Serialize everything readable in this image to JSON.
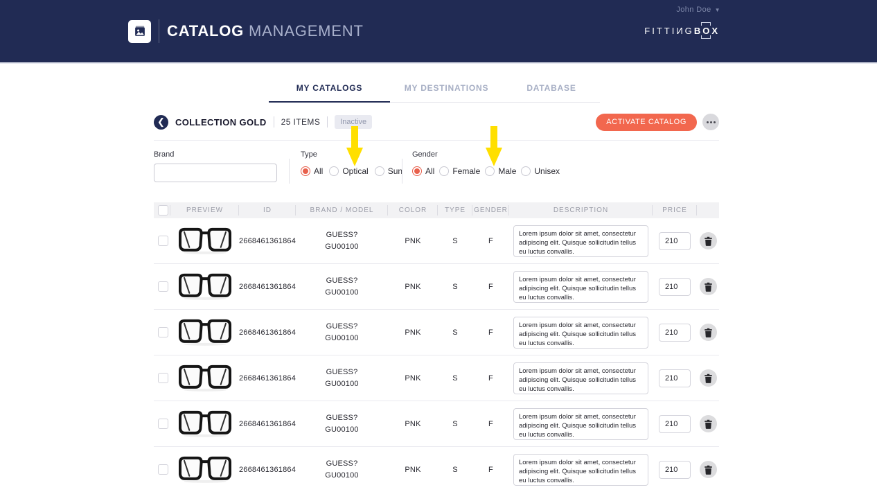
{
  "header": {
    "user_menu": "John Doe",
    "title_bold": "CATALOG",
    "title_light": "MANAGEMENT",
    "brand_part1": "FITTIИG",
    "brand_b": "B",
    "brand_o": "O",
    "brand_x": "X"
  },
  "tabs": [
    {
      "label": "MY CATALOGS",
      "active": true
    },
    {
      "label": "MY DESTINATIONS",
      "active": false
    },
    {
      "label": "DATABASE",
      "active": false
    }
  ],
  "collection": {
    "name": "COLLECTION GOLD",
    "items_count": "25 ITEMS",
    "status": "Inactive",
    "activate_button": "ACTIVATE CATALOG",
    "more_icon": "ellipsis"
  },
  "filters": {
    "brand": {
      "label": "Brand",
      "value": ""
    },
    "type": {
      "label": "Type",
      "options": [
        "All",
        "Optical",
        "Sun"
      ],
      "selected": "All"
    },
    "gender": {
      "label": "Gender",
      "options": [
        "All",
        "Female",
        "Male",
        "Unisex"
      ],
      "selected": "All"
    }
  },
  "annotations": {
    "arrow_color": "#ffdf00",
    "arrows": [
      {
        "points_at": "Optical"
      },
      {
        "points_at": "Male"
      }
    ]
  },
  "table": {
    "columns": [
      "",
      "PREVIEW",
      "ID",
      "BRAND / MODEL",
      "COLOR",
      "TYPE",
      "GENDER",
      "DESCRIPTION",
      "PRICE",
      ""
    ],
    "rows": [
      {
        "id": "2668461361864",
        "brand": "GUESS?",
        "model": "GU00100",
        "color": "PNK",
        "type": "S",
        "gender": "F",
        "description": "Lorem ipsum dolor sit amet, consectetur adipiscing elit. Quisque sollicitudin tellus eu luctus convallis.",
        "price": "210"
      },
      {
        "id": "2668461361864",
        "brand": "GUESS?",
        "model": "GU00100",
        "color": "PNK",
        "type": "S",
        "gender": "F",
        "description": "Lorem ipsum dolor sit amet, consectetur adipiscing elit. Quisque sollicitudin tellus eu luctus convallis.",
        "price": "210"
      },
      {
        "id": "2668461361864",
        "brand": "GUESS?",
        "model": "GU00100",
        "color": "PNK",
        "type": "S",
        "gender": "F",
        "description": "Lorem ipsum dolor sit amet, consectetur adipiscing elit. Quisque sollicitudin tellus eu luctus convallis.",
        "price": "210"
      },
      {
        "id": "2668461361864",
        "brand": "GUESS?",
        "model": "GU00100",
        "color": "PNK",
        "type": "S",
        "gender": "F",
        "description": "Lorem ipsum dolor sit amet, consectetur adipiscing elit. Quisque sollicitudin tellus eu luctus convallis.",
        "price": "210"
      },
      {
        "id": "2668461361864",
        "brand": "GUESS?",
        "model": "GU00100",
        "color": "PNK",
        "type": "S",
        "gender": "F",
        "description": "Lorem ipsum dolor sit amet, consectetur adipiscing elit. Quisque sollicitudin tellus eu luctus convallis.",
        "price": "210"
      },
      {
        "id": "2668461361864",
        "brand": "GUESS?",
        "model": "GU00100",
        "color": "PNK",
        "type": "S",
        "gender": "F",
        "description": "Lorem ipsum dolor sit amet, consectetur adipiscing elit. Quisque sollicitudin tellus eu luctus convallis.",
        "price": "210"
      }
    ]
  },
  "colors": {
    "header_navy": "#212b54",
    "accent_coral": "#f2674e",
    "radio_selected": "#e8604c",
    "annotation_yellow": "#ffdf00",
    "badge_bg": "#e9eaf1"
  }
}
